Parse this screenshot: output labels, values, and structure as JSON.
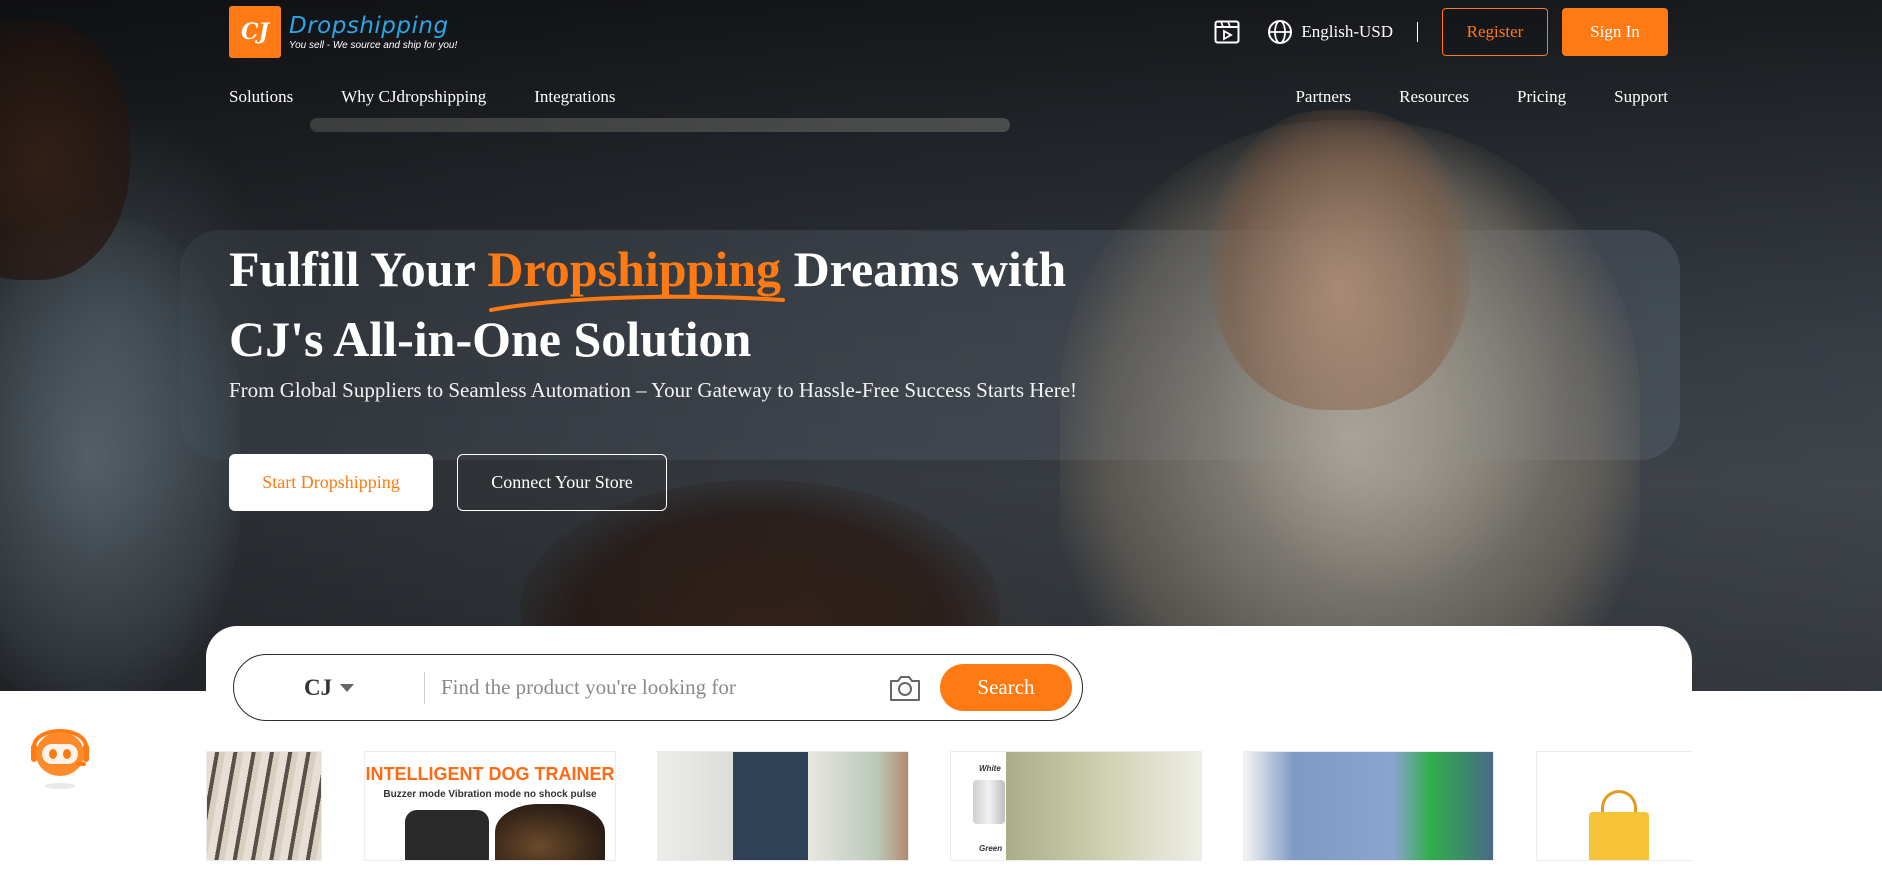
{
  "brand": {
    "logo_mark": "CJ",
    "name": "Dropshipping",
    "tagline": "You sell - We source and ship for you!",
    "accent_color": "#ff7a12",
    "name_color": "#2aa6e8"
  },
  "header": {
    "video_icon": "video-icon",
    "language_label": "English-USD",
    "register_label": "Register",
    "signin_label": "Sign In"
  },
  "nav": {
    "left": [
      "Solutions",
      "Why CJdropshipping",
      "Integrations"
    ],
    "right": [
      "Partners",
      "Resources",
      "Pricing",
      "Support"
    ]
  },
  "hero": {
    "headline_before": "Fulfill Your",
    "headline_highlight": "Dropshipping",
    "headline_after": "Dreams with",
    "headline_line2": "CJ's All-in-One Solution",
    "subline": "From Global Suppliers to Seamless Automation – Your Gateway to Hassle-Free Success Starts Here!",
    "primary_cta": "Start Dropshipping",
    "secondary_cta": "Connect Your Store"
  },
  "search": {
    "scope": "CJ",
    "placeholder": "Find the product you're looking for",
    "button_label": "Search",
    "camera_icon": "camera-icon"
  },
  "products": {
    "dog_trainer_title": "INTELLIGENT DOG TRAINER",
    "dog_trainer_subtitle": "Buzzer mode Vibration mode no shock pulse",
    "cup_label_white": "White",
    "cup_label_green": "Green"
  },
  "assistant": {
    "icon": "robot-assistant-icon"
  }
}
